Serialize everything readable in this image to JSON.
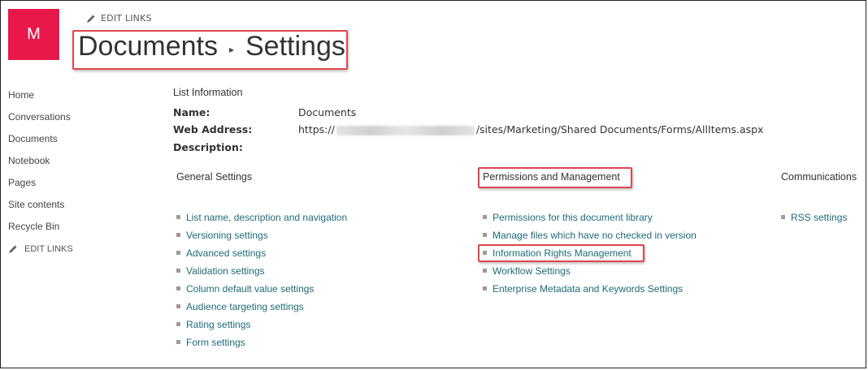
{
  "header": {
    "logo_letter": "M",
    "edit_links": "EDIT LINKS",
    "breadcrumb": [
      "Documents",
      "Settings"
    ],
    "separator": "▸"
  },
  "left_nav": {
    "items": [
      "Home",
      "Conversations",
      "Documents",
      "Notebook",
      "Pages",
      "Site contents",
      "Recycle Bin"
    ],
    "edit_links": "EDIT LINKS"
  },
  "list_info": {
    "heading": "List Information",
    "name_label": "Name:",
    "name_value": "Documents",
    "web_address_label": "Web Address:",
    "web_address_prefix": "https://",
    "web_address_suffix": "/sites/Marketing/Shared Documents/Forms/AllItems.aspx",
    "description_label": "Description:"
  },
  "general_settings": {
    "heading": "General Settings",
    "links": [
      "List name, description and navigation",
      "Versioning settings",
      "Advanced settings",
      "Validation settings",
      "Column default value settings",
      "Audience targeting settings",
      "Rating settings",
      "Form settings"
    ]
  },
  "permissions": {
    "heading": "Permissions and Management",
    "links": [
      "Permissions for this document library",
      "Manage files which have no checked in version",
      "Information Rights Management",
      "Workflow Settings",
      "Enterprise Metadata and Keywords Settings"
    ]
  },
  "communications": {
    "heading": "Communications",
    "links": [
      "RSS settings"
    ]
  },
  "colors": {
    "logo_bg": "#e8194a",
    "link": "#1f6a7a",
    "highlight_border": "#e0454f"
  }
}
